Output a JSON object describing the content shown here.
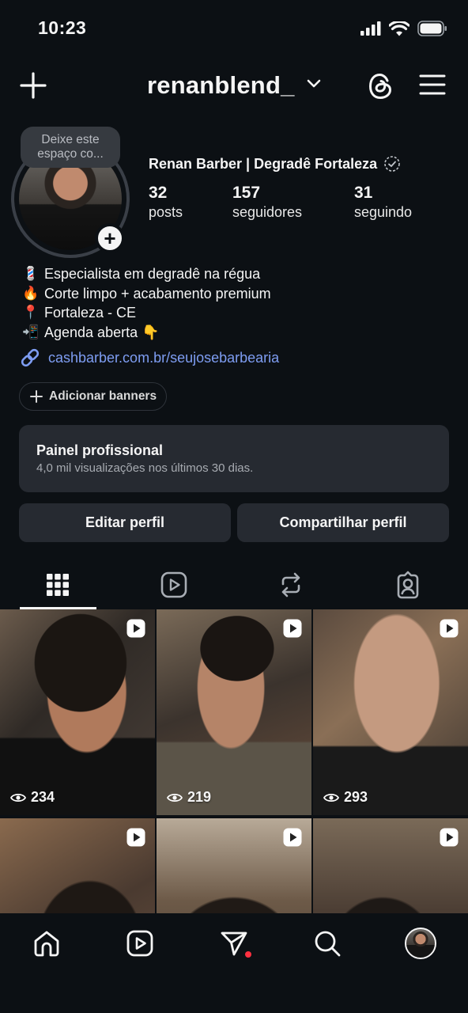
{
  "status_bar": {
    "time": "10:23"
  },
  "header": {
    "username": "renanblend_"
  },
  "profile": {
    "note": "Deixe este espaço co...",
    "display_name": "Renan Barber | Degradê Fortaleza",
    "stats": [
      {
        "value": "32",
        "label": "posts"
      },
      {
        "value": "157",
        "label": "seguidores"
      },
      {
        "value": "31",
        "label": "seguindo"
      }
    ],
    "bio": [
      {
        "emoji": "💈",
        "text": "Especialista em degradê na régua"
      },
      {
        "emoji": "🔥",
        "text": "Corte limpo + acabamento premium"
      },
      {
        "emoji": "📍",
        "text": "Fortaleza - CE"
      },
      {
        "emoji": "📲",
        "text": "Agenda aberta 👇"
      }
    ],
    "link": "cashbarber.com.br/seujosebarbearia",
    "add_banners": "Adicionar banners"
  },
  "panel": {
    "title": "Painel profissional",
    "subtitle": "4,0 mil visualizações nos últimos 30 dias."
  },
  "buttons": {
    "edit": "Editar perfil",
    "share": "Compartilhar perfil"
  },
  "tabs": [
    "grid-icon",
    "reels-icon",
    "reposts-icon",
    "tagged-icon"
  ],
  "posts": [
    {
      "views": "234"
    },
    {
      "views": "219"
    },
    {
      "views": "293"
    },
    {
      "views": ""
    },
    {
      "views": ""
    },
    {
      "views": ""
    }
  ],
  "bottom_nav": [
    "home-icon",
    "reels-icon",
    "direct-icon",
    "search-icon",
    "profile-avatar"
  ],
  "colors": {
    "background": "#0c1014",
    "card": "#262a31",
    "link": "#7e9df2",
    "notification": "#ff3040"
  }
}
